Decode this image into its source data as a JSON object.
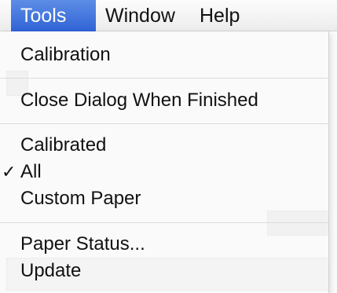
{
  "menubar": {
    "items": [
      {
        "label": "Tools",
        "active": true
      },
      {
        "label": "Window",
        "active": false
      },
      {
        "label": "Help",
        "active": false
      }
    ]
  },
  "tools_menu": {
    "items": [
      {
        "label": "Calibration"
      },
      {
        "label": "Close Dialog When Finished"
      },
      {
        "label": "Calibrated"
      },
      {
        "label": "All",
        "checked": true,
        "check_glyph": "✓"
      },
      {
        "label": "Custom Paper"
      },
      {
        "label": "Paper Status..."
      },
      {
        "label": "Update"
      }
    ]
  },
  "colors": {
    "menu_highlight": "#3a6fdc",
    "menu_text": "#111111",
    "separator": "#dcdcdc"
  }
}
